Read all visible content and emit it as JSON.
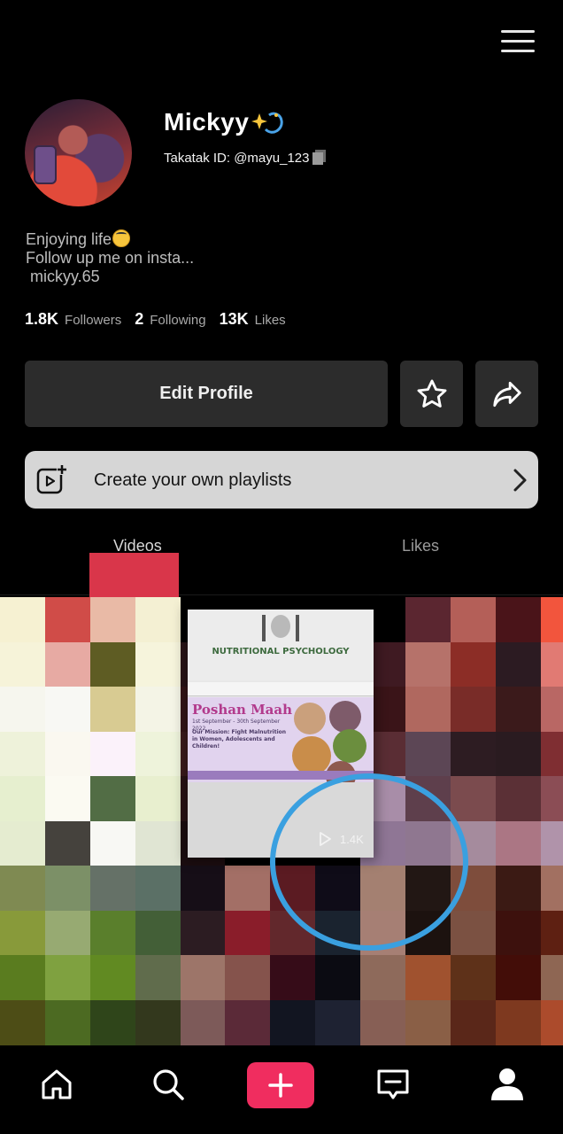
{
  "header": {
    "menu_icon": "hamburger-menu-icon"
  },
  "profile": {
    "username": "Mickyy",
    "username_emoji": "sparkle-emoji",
    "takatak_id_label": "Takatak ID: @mayu_123",
    "bio_lines": [
      "Enjoying life",
      "Follow up me on insta...",
      " mickyy.65"
    ]
  },
  "stats": {
    "followers_count": "1.8K",
    "followers_label": "Followers",
    "following_count": "2",
    "following_label": "Following",
    "likes_count": "13K",
    "likes_label": "Likes"
  },
  "actions": {
    "edit_profile_label": "Edit Profile",
    "favorite_icon": "star-icon",
    "share_icon": "share-arrow-icon"
  },
  "playlist": {
    "label": "Create your own playlists",
    "icon": "playlist-add-icon"
  },
  "tabs": [
    {
      "label": "Videos",
      "active": true
    },
    {
      "label": "Likes",
      "active": false
    }
  ],
  "video_grid": {
    "featured_thumbnail": {
      "heading": "NUTRITIONAL PSYCHOLOGY",
      "title": "Poshan Maah",
      "subtitle": "1st September - 30th September 2022",
      "mission": "Our Mission: Fight Malnutrition in Women, Adolescents and Children!",
      "views": "1.4K"
    }
  },
  "annotation": {
    "color": "#3aa0e0"
  },
  "bottom_nav": {
    "items": [
      "home-icon",
      "search-icon",
      "create-plus-icon",
      "inbox-message-icon",
      "profile-icon"
    ],
    "accent": "#f02d5f"
  }
}
